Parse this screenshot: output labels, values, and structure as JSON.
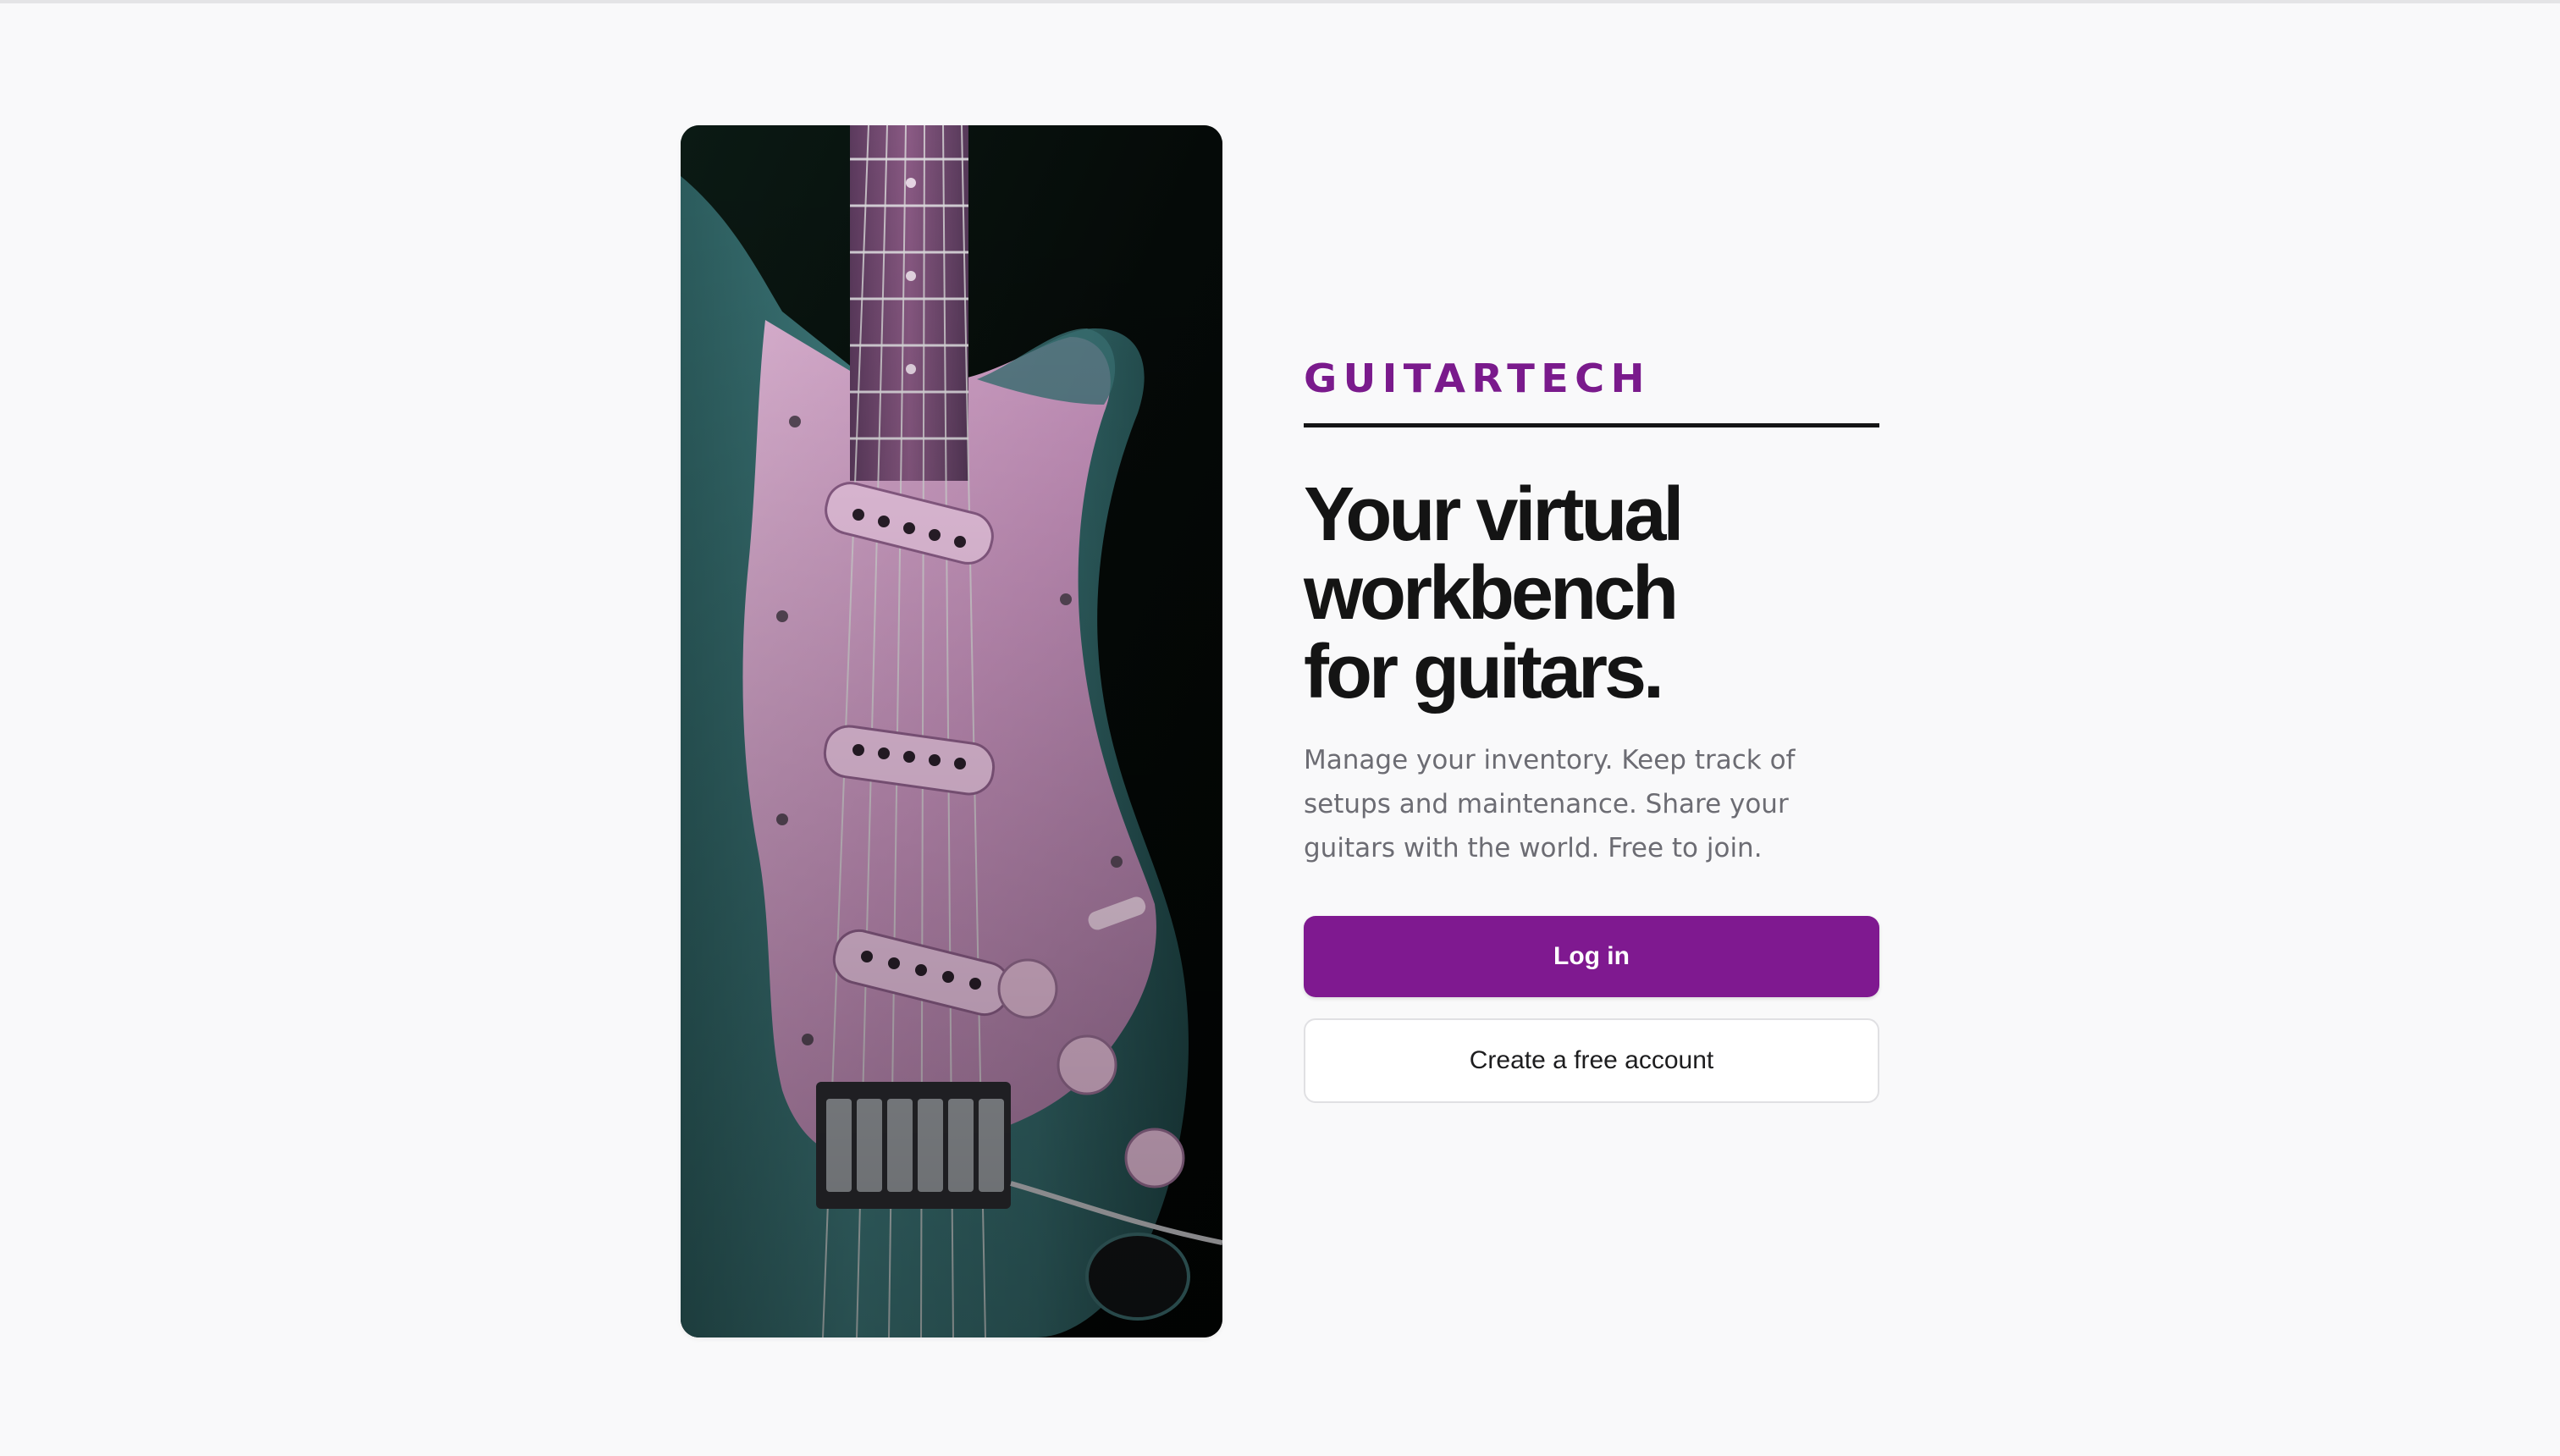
{
  "brand": {
    "name": "GUITARTECH",
    "accent_color": "#7f1990"
  },
  "hero": {
    "headline_lines": [
      "Your virtual",
      "workbench",
      "for guitars."
    ],
    "subtext_lines": [
      "Manage your inventory. Keep track of",
      "setups and maintenance. Share your",
      "guitars with the world. Free to join."
    ]
  },
  "actions": {
    "login_label": "Log in",
    "create_account_label": "Create a free account"
  },
  "image": {
    "icon": "electric-guitar-photo"
  }
}
